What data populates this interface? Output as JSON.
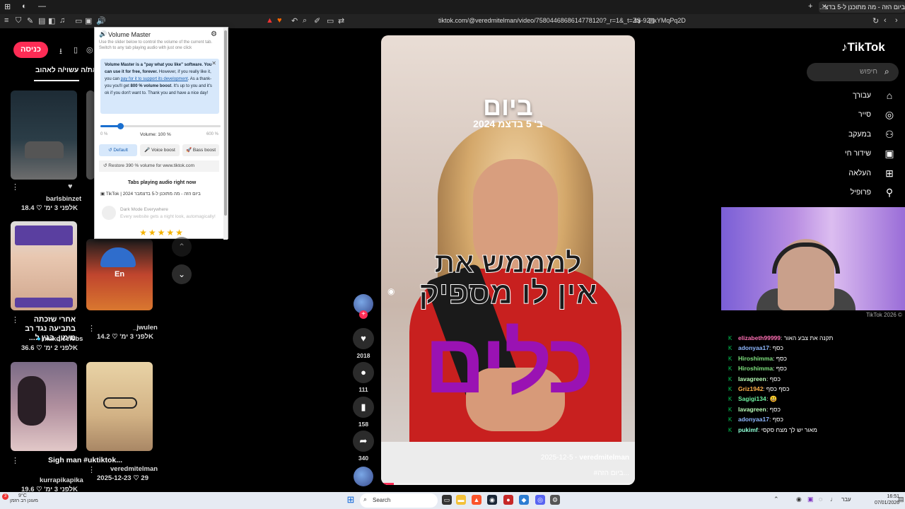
{
  "browser": {
    "active_tab_title": "ביום הזה - מה מתוכנן ל-5 בדצ...",
    "url": "tiktok.com/@veredmitelman/video/7580446868614778120?_r=1&_t=ZS-92nxYMqPq2D"
  },
  "left": {
    "login_button": "כניסה",
    "liked_tab": "את/ה עשוי/ה לאהוב",
    "thumbs": [
      {
        "user": "barlsbinzet",
        "views": "18.4K",
        "time": "לפני 3 ימ'",
        "title": ""
      },
      {
        "user": "mako.celebs",
        "views": "36.6K",
        "time": "לפני 2 ימ'",
        "title": "אחרי שזכתה בתביעה נגד רב מימון, בגין ל..."
      },
      {
        "user": "_jwulen",
        "views": "14.2K",
        "time": "לפני 3 ימ'",
        "title": ""
      },
      {
        "user": "kurrapikapika",
        "views": "19.6K",
        "time": "לפני 3 ימ'",
        "title": "Sigh man #uktiktok..."
      },
      {
        "user": "veredmitelman",
        "views": "29",
        "time": "2025-12-23",
        "title": ""
      }
    ],
    "thumb_overlay_word": "En"
  },
  "volume_master": {
    "title": "Volume Master",
    "subtitle": "Use the slider below to control the volume of the current tab. Switch to any tab playing audio with just one click",
    "note_bold": "Volume Master is a \"pay what you like\" software. You can use it for free, forever.",
    "note_text_1": "However, if you really like it, you can",
    "note_link": "pay for it to support its development",
    "note_bold_2": "800 % volume boost",
    "note_text_2": ". As a thank-you you'll get",
    "note_text_3": ". It's up to you and it's ok if you don't want to. Thank you and have a nice day!",
    "slider_min": "0 %",
    "slider_max": "600 %",
    "volume_label": "Volume: 100 %",
    "volume_fraction": 0.1667,
    "btn_default": "Default",
    "btn_voice": "Voice boost",
    "btn_bass": "Bass boost",
    "restore": "Restore 390 % volume for www.tiktok.com",
    "tabs_title": "Tabs playing audio right now",
    "tab_row": "TikTok | ביום הזה - מה מתוכנן ל-5 בדצמבר 2024",
    "dark_title": "Dark Mode Everywhere",
    "dark_sub": "Every website gets a night look, automagically!",
    "stars": "★★★★★"
  },
  "video": {
    "line1": "ביום",
    "line2": "ב' 5 בדצמ 2024",
    "line3": "למממש את",
    "line4": "אין לו מספיק",
    "line5": "כלים",
    "author": "veredmitelman",
    "date": "2025-12-5",
    "caption": "#ביום הזה...",
    "progress": 0.05
  },
  "actions": {
    "likes": "2018",
    "comments": "111",
    "saves": "158",
    "shares": "340"
  },
  "right": {
    "logo": "TikTok",
    "search_placeholder": "חיפוש",
    "nav": [
      "עבורך",
      "סייר",
      "במעקב",
      "שידור חי",
      "העלאה",
      "פרופיל"
    ],
    "copyright": "TikTok 2026 ©"
  },
  "chat": [
    {
      "user": "elizabeth99999",
      "color": "#ff6fb4",
      "msg": "תקנה את צבע האור"
    },
    {
      "user": "adonyaa17",
      "color": "#8fb8ff",
      "msg": "כסף"
    },
    {
      "user": "Hiroshimma",
      "color": "#7ee07e",
      "msg": "כסף"
    },
    {
      "user": "Hiroshimma",
      "color": "#7ee07e",
      "msg": "כסף"
    },
    {
      "user": "lavagreen",
      "color": "#b9ffb9",
      "msg": "כסף"
    },
    {
      "user": "Griz1942",
      "color": "#ffb14a",
      "msg": "כסף כסף"
    },
    {
      "user": "Sagigi134",
      "color": "#6ef2a0",
      "msg": "😃"
    },
    {
      "user": "lavagreen",
      "color": "#b9ffb9",
      "msg": "כסף"
    },
    {
      "user": "adonyaa17",
      "color": "#8fb8ff",
      "msg": "כסף"
    },
    {
      "user": "pukimf",
      "color": "#8fffd6",
      "msg": "מאור יש לך מצח סקסי"
    }
  ],
  "taskbar": {
    "weather_temp": "9°C",
    "weather_text": "מעונן רב הזמן",
    "search_label": "Search",
    "lang": "עבר",
    "time": "16:51",
    "date": "07/01/2026"
  }
}
